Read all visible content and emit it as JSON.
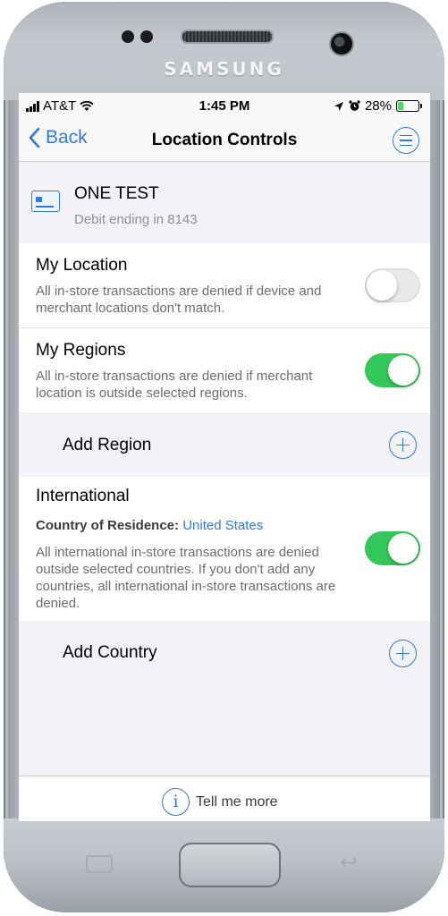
{
  "device": {
    "brand": "SAMSUNG"
  },
  "status_bar": {
    "carrier": "AT&T",
    "time": "1:45 PM",
    "battery": "28%",
    "battery_level": 0.28
  },
  "nav": {
    "back_label": "Back",
    "title": "Location Controls"
  },
  "card": {
    "name": "ONE TEST",
    "subtitle": "Debit ending in 8143"
  },
  "my_location": {
    "title": "My Location",
    "description": "All in-store transactions are denied if device and merchant locations don't match.",
    "enabled": false
  },
  "my_regions": {
    "title": "My Regions",
    "description": "All in-store transactions are denied if merchant location is outside selected regions.",
    "enabled": true
  },
  "add_region": {
    "label": "Add Region"
  },
  "international": {
    "title": "International",
    "residence_label": "Country of Residence:",
    "residence_value": "United States",
    "description": "All international in-store transactions are denied outside selected countries. If you don't add any countries, all international in-store transactions are denied.",
    "enabled": true
  },
  "add_country": {
    "label": "Add Country"
  },
  "footer": {
    "label": "Tell me more"
  },
  "colors": {
    "accent": "#2d7ae6",
    "toggle_on": "#34c759"
  }
}
